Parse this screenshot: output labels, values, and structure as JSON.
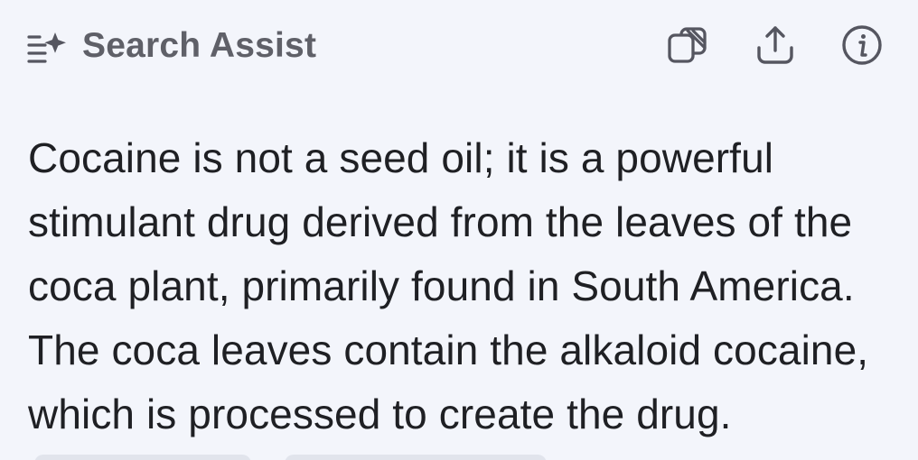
{
  "header": {
    "title": "Search Assist",
    "icon": "sparkle-list-icon",
    "actions": [
      {
        "name": "copy",
        "icon": "copy-icon"
      },
      {
        "name": "share",
        "icon": "share-icon"
      },
      {
        "name": "info",
        "icon": "info-icon"
      }
    ]
  },
  "answer": {
    "lines": [
      "Cocaine is not a seed oil; it is a powerful",
      "stimulant drug derived from the leaves of the",
      "coca plant, primarily found in South America.",
      "The coca leaves contain the alkaloid cocaine,",
      "which is processed to create the drug."
    ]
  },
  "colors": {
    "background": "#f3f5fb",
    "title": "#5f6068",
    "text": "#1f2024",
    "icon": "#555660"
  }
}
